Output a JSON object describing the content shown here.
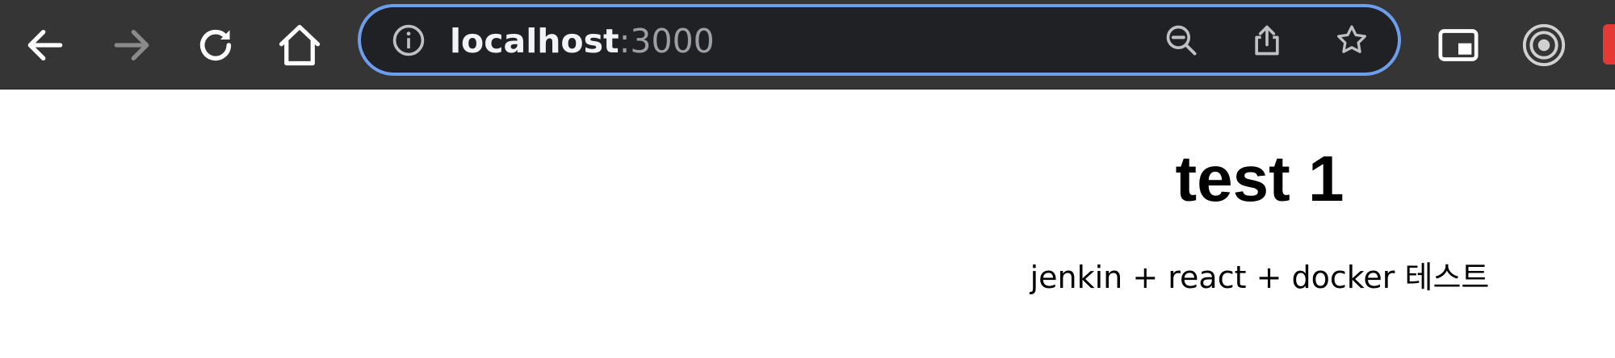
{
  "browser": {
    "nav": {
      "back_icon": "arrow-left-icon",
      "forward_icon": "arrow-right-icon",
      "reload_icon": "reload-icon",
      "home_icon": "home-icon"
    },
    "address_bar": {
      "host": "localhost",
      "port": ":3000",
      "info_icon": "info-icon",
      "zoom_icon": "zoom-out-icon",
      "share_icon": "share-icon",
      "bookmark_icon": "star-icon"
    },
    "extensions": [
      "picture-in-picture-icon",
      "radio-target-icon",
      "extension-badge-icon"
    ],
    "colors": {
      "toolbar_bg": "#353535",
      "omnibox_bg": "#202124",
      "omnibox_focus_ring": "#6d9eed",
      "url_host": "#f1f3f4",
      "url_port": "#9aa0a6"
    }
  },
  "page": {
    "title": "test 1",
    "description": "jenkin + react + docker 테스트"
  }
}
